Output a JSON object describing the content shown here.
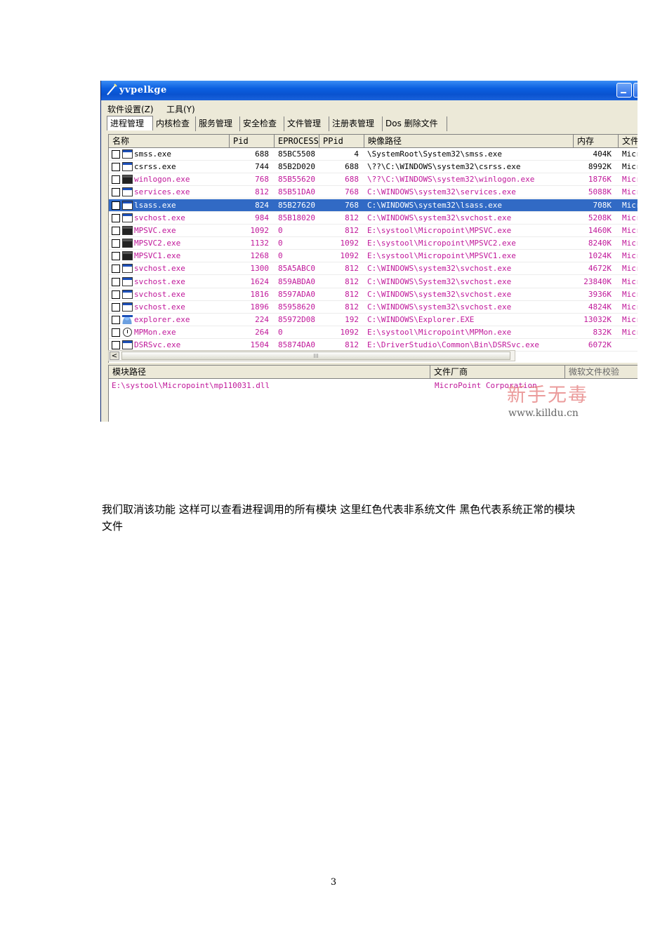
{
  "window": {
    "title": "yvpelkge",
    "menu": [
      "软件设置(Z)",
      "工具(Y)"
    ],
    "tabs": [
      "进程管理",
      "内核检查",
      "服务管理",
      "安全检查",
      "文件管理",
      "注册表管理",
      "Dos 删除文件"
    ],
    "active_tab": 0,
    "process_table": {
      "columns": [
        "名称",
        "Pid",
        "EPROCESS",
        "PPid",
        "映像路径",
        "内存",
        "文件"
      ],
      "rows": [
        {
          "name": "smss.exe",
          "pid": "688",
          "eprocess": "85BC5508",
          "ppid": "4",
          "path": "\\SystemRoot\\System32\\smss.exe",
          "mem": "404K",
          "company": "Micr",
          "color": "black",
          "icon": "window"
        },
        {
          "name": "csrss.exe",
          "pid": "744",
          "eprocess": "85B2D020",
          "ppid": "688",
          "path": "\\??\\C:\\WINDOWS\\system32\\csrss.exe",
          "mem": "8992K",
          "company": "Micr",
          "color": "black",
          "icon": "window"
        },
        {
          "name": "winlogon.exe",
          "pid": "768",
          "eprocess": "85B55620",
          "ppid": "688",
          "path": "\\??\\C:\\WINDOWS\\system32\\winlogon.exe",
          "mem": "1876K",
          "company": "Micr",
          "color": "red",
          "icon": "lock"
        },
        {
          "name": "services.exe",
          "pid": "812",
          "eprocess": "85B51DA0",
          "ppid": "768",
          "path": "C:\\WINDOWS\\system32\\services.exe",
          "mem": "5088K",
          "company": "Micr",
          "color": "red",
          "icon": "window"
        },
        {
          "name": "lsass.exe",
          "pid": "824",
          "eprocess": "85B27620",
          "ppid": "768",
          "path": "C:\\WINDOWS\\system32\\lsass.exe",
          "mem": "708K",
          "company": "Micr",
          "color": "selected",
          "icon": "window"
        },
        {
          "name": "svchost.exe",
          "pid": "984",
          "eprocess": "85B18020",
          "ppid": "812",
          "path": "C:\\WINDOWS\\system32\\svchost.exe",
          "mem": "5208K",
          "company": "Micr",
          "color": "red",
          "icon": "window"
        },
        {
          "name": "MPSVC.exe",
          "pid": "1092",
          "eprocess": "0",
          "ppid": "812",
          "path": "E:\\systool\\Micropoint\\MPSVC.exe",
          "mem": "1460K",
          "company": "Micr",
          "color": "red",
          "icon": "dark"
        },
        {
          "name": "MPSVC2.exe",
          "pid": "1132",
          "eprocess": "0",
          "ppid": "1092",
          "path": "E:\\systool\\Micropoint\\MPSVC2.exe",
          "mem": "8240K",
          "company": "Micr",
          "color": "red",
          "icon": "dark"
        },
        {
          "name": "MPSVC1.exe",
          "pid": "1268",
          "eprocess": "0",
          "ppid": "1092",
          "path": "E:\\systool\\Micropoint\\MPSVC1.exe",
          "mem": "1024K",
          "company": "Micr",
          "color": "red",
          "icon": "dark"
        },
        {
          "name": "svchost.exe",
          "pid": "1300",
          "eprocess": "85A5ABC0",
          "ppid": "812",
          "path": "C:\\WINDOWS\\system32\\svchost.exe",
          "mem": "4672K",
          "company": "Micr",
          "color": "red",
          "icon": "window"
        },
        {
          "name": "svchost.exe",
          "pid": "1624",
          "eprocess": "859ABDA0",
          "ppid": "812",
          "path": "C:\\WINDOWS\\System32\\svchost.exe",
          "mem": "23840K",
          "company": "Micr",
          "color": "red",
          "icon": "window"
        },
        {
          "name": "svchost.exe",
          "pid": "1816",
          "eprocess": "8597ADA0",
          "ppid": "812",
          "path": "C:\\WINDOWS\\system32\\svchost.exe",
          "mem": "3936K",
          "company": "Micr",
          "color": "red",
          "icon": "window"
        },
        {
          "name": "svchost.exe",
          "pid": "1896",
          "eprocess": "85958620",
          "ppid": "812",
          "path": "C:\\WINDOWS\\system32\\svchost.exe",
          "mem": "4824K",
          "company": "Micr",
          "color": "red",
          "icon": "window"
        },
        {
          "name": "explorer.exe",
          "pid": "224",
          "eprocess": "85972D08",
          "ppid": "192",
          "path": "C:\\WINDOWS\\Explorer.EXE",
          "mem": "13032K",
          "company": "Micr",
          "color": "red",
          "icon": "person"
        },
        {
          "name": "MPMon.exe",
          "pid": "264",
          "eprocess": "0",
          "ppid": "1092",
          "path": "E:\\systool\\Micropoint\\MPMon.exe",
          "mem": "832K",
          "company": "Micr",
          "color": "red",
          "icon": "clock"
        },
        {
          "name": "DSRSvc.exe",
          "pid": "1504",
          "eprocess": "85874DA0",
          "ppid": "812",
          "path": "E:\\DriverStudio\\Common\\Bin\\DSRSvc.exe",
          "mem": "6072K",
          "company": "",
          "color": "red",
          "icon": "window"
        }
      ]
    },
    "scroll_left_arrow": "<",
    "scroll_thumb_grip": "III",
    "module_table": {
      "columns": [
        "模块路径",
        "文件厂商",
        "微软文件校验"
      ],
      "rows": [
        {
          "path": "E:\\systool\\Micropoint\\mp110031.dll",
          "vendor": "MicroPoint Corporation",
          "verify": ""
        }
      ]
    },
    "watermark": {
      "text": "新手无毒",
      "url": "www.killdu.cn"
    }
  },
  "caption": "我们取消该功能 这样可以查看进程调用的所有模块 这里红色代表非系统文件 黑色代表系统正常的模块文件",
  "page_number": "3"
}
